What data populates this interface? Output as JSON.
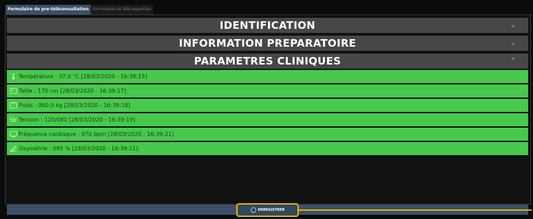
{
  "tabs": [
    {
      "label": "Formulaire de pre-téléconsultation",
      "active": true
    },
    {
      "label": "Formulaire de télé-expertise",
      "active": false
    }
  ],
  "sections": {
    "identification": {
      "label": "IDENTIFICATION",
      "chevron": "⌄"
    },
    "information": {
      "label": "INFORMATION PREPARATOIRE",
      "chevron": "⌄"
    },
    "parametres": {
      "label": "PARAMETRES CLINIQUES",
      "chevron": "⌃"
    }
  },
  "vitals": [
    {
      "icon": "thermometer-icon",
      "text": "Température : 37,0 °C [28/03/2020 - 16:39:15]"
    },
    {
      "icon": "height-icon",
      "text": "Taille : 170 cm [28/03/2020 - 16:39:17]"
    },
    {
      "icon": "scale-icon",
      "text": "Poids : 060,0 kg [28/03/2020 - 16:39:18]"
    },
    {
      "icon": "stethoscope-icon",
      "text": "Tension : 120/080 [28/03/2020 - 16:39:19]"
    },
    {
      "icon": "monitor-icon",
      "text": "Fréquence cardiaque : 070 bpm [28/03/2020 - 16:39:21]"
    },
    {
      "icon": "oximeter-icon",
      "text": "Oxymétrie : 095 % [28/03/2020 - 16:39:21]"
    }
  ],
  "footer": {
    "save_label": "ENREGISTRER"
  },
  "colors": {
    "accent": "#3b5068",
    "rows": "#47c94c",
    "highlight": "#e8b500",
    "section": "#474747"
  }
}
